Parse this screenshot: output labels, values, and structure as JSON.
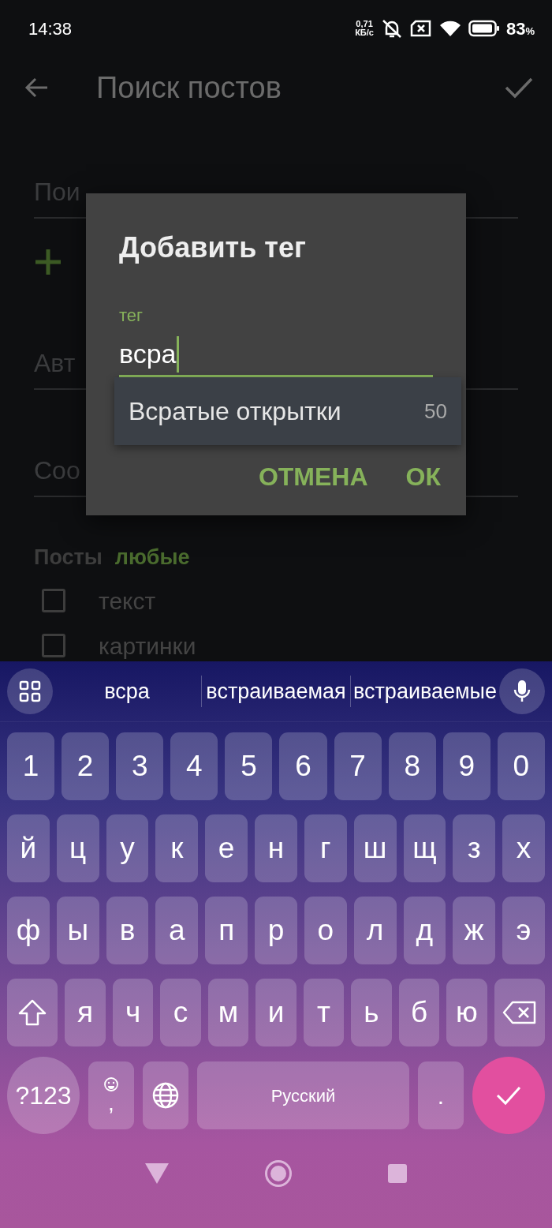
{
  "status_bar": {
    "time": "14:38",
    "net_speed": "0,71",
    "net_unit": "КБ/с",
    "battery_value": "83",
    "battery_unit": "%"
  },
  "app_bar": {
    "title": "Поиск постов"
  },
  "form": {
    "fields": [
      {
        "label": "Пои"
      },
      {
        "label": "Авт"
      },
      {
        "label": "Соо"
      }
    ],
    "posts_filter": {
      "label": "Посты",
      "value": "любые"
    },
    "checkboxes": [
      {
        "label": "текст",
        "checked": false
      },
      {
        "label": "картинки",
        "checked": false
      }
    ]
  },
  "dialog": {
    "title": "Добавить тег",
    "field_label": "тег",
    "value": "всра",
    "suggestion": {
      "text": "Всратые открытки",
      "count": "50"
    },
    "buttons": [
      "ОТМЕНА",
      "ОК"
    ]
  },
  "keyboard": {
    "suggestions": [
      "всра",
      "встраиваемая",
      "встраиваемые"
    ],
    "rows": [
      {
        "keys": [
          {
            "kind": "char",
            "label": "1"
          },
          {
            "kind": "char",
            "label": "2"
          },
          {
            "kind": "char",
            "label": "3"
          },
          {
            "kind": "char",
            "label": "4"
          },
          {
            "kind": "char",
            "label": "5"
          },
          {
            "kind": "char",
            "label": "6"
          },
          {
            "kind": "char",
            "label": "7"
          },
          {
            "kind": "char",
            "label": "8"
          },
          {
            "kind": "char",
            "label": "9"
          },
          {
            "kind": "char",
            "label": "0"
          }
        ]
      },
      {
        "keys": [
          {
            "kind": "char",
            "label": "й"
          },
          {
            "kind": "char",
            "label": "ц"
          },
          {
            "kind": "char",
            "label": "у"
          },
          {
            "kind": "char",
            "label": "к"
          },
          {
            "kind": "char",
            "label": "е"
          },
          {
            "kind": "char",
            "label": "н"
          },
          {
            "kind": "char",
            "label": "г"
          },
          {
            "kind": "char",
            "label": "ш"
          },
          {
            "kind": "char",
            "label": "щ"
          },
          {
            "kind": "char",
            "label": "з"
          },
          {
            "kind": "char",
            "label": "х"
          }
        ]
      },
      {
        "keys": [
          {
            "kind": "char",
            "label": "ф"
          },
          {
            "kind": "char",
            "label": "ы"
          },
          {
            "kind": "char",
            "label": "в"
          },
          {
            "kind": "char",
            "label": "а"
          },
          {
            "kind": "char",
            "label": "п"
          },
          {
            "kind": "char",
            "label": "р"
          },
          {
            "kind": "char",
            "label": "о"
          },
          {
            "kind": "char",
            "label": "л"
          },
          {
            "kind": "char",
            "label": "д"
          },
          {
            "kind": "char",
            "label": "ж"
          },
          {
            "kind": "char",
            "label": "э"
          }
        ]
      },
      {
        "keys": [
          {
            "kind": "shift"
          },
          {
            "kind": "char",
            "label": "я"
          },
          {
            "kind": "char",
            "label": "ч"
          },
          {
            "kind": "char",
            "label": "с"
          },
          {
            "kind": "char",
            "label": "м"
          },
          {
            "kind": "char",
            "label": "и"
          },
          {
            "kind": "char",
            "label": "т"
          },
          {
            "kind": "char",
            "label": "ь"
          },
          {
            "kind": "char",
            "label": "б"
          },
          {
            "kind": "char",
            "label": "ю"
          },
          {
            "kind": "backspace"
          }
        ]
      },
      {
        "keys": [
          {
            "kind": "symbols",
            "label": "?123"
          },
          {
            "kind": "emoji_comma",
            "label": ","
          },
          {
            "kind": "globe"
          },
          {
            "kind": "space",
            "label": "Русский"
          },
          {
            "kind": "char",
            "label": "."
          },
          {
            "kind": "enter"
          }
        ]
      }
    ]
  }
}
